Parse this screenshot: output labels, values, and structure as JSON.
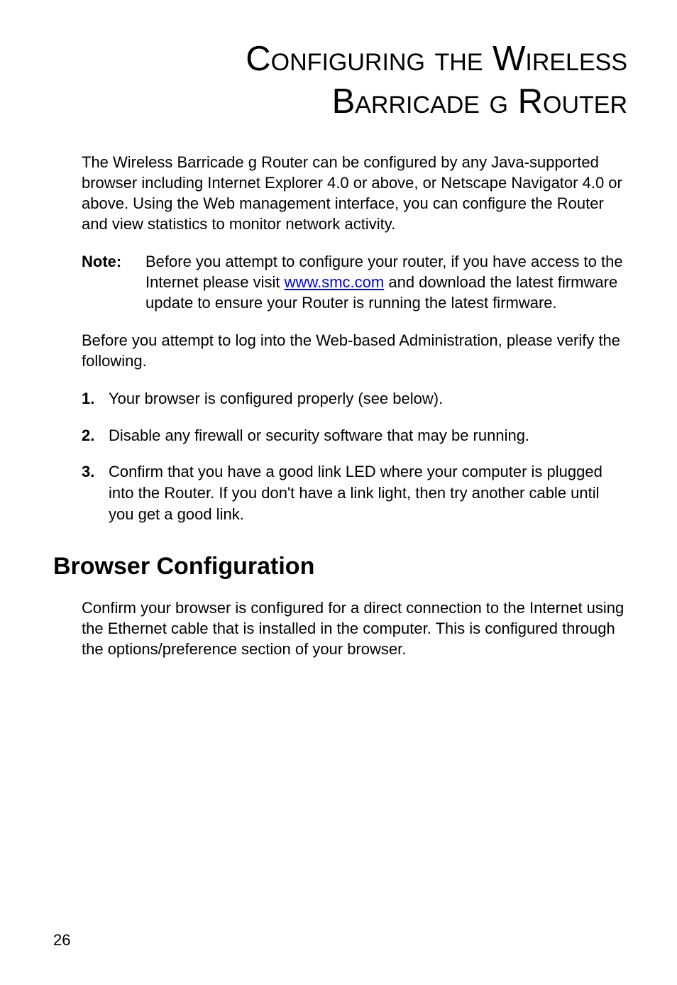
{
  "title_line1": "Configuring the Wireless",
  "title_line2": "Barricade g Router",
  "intro": "The Wireless Barricade g Router can be configured by any Java-supported browser including Internet Explorer 4.0 or above, or Netscape Navigator 4.0 or above. Using the Web management interface, you can configure the Router and view statistics to monitor network activity.",
  "note": {
    "label": "Note:",
    "before_link": "Before you attempt to configure your router, if you have access to the Internet please visit ",
    "link_text": "www.smc.com",
    "after_link": " and download the latest firmware update to ensure your Router is running the latest firmware."
  },
  "pre_list": "Before you attempt to log into the Web-based Administration, please verify the following.",
  "items": [
    {
      "num": "1.",
      "text": "Your browser is configured properly (see below)."
    },
    {
      "num": "2.",
      "text": "Disable any firewall or security software that may be running."
    },
    {
      "num": "3.",
      "text": "Confirm that you have a good link LED where your computer is plugged into the Router. If you don't have a link light, then try another cable until you get a good link."
    }
  ],
  "section_heading": "Browser Configuration",
  "section_body": "Confirm your browser is configured for a direct connection to the Internet using the Ethernet cable that is installed in the computer. This is configured through the options/preference section of your browser.",
  "page_number": "26"
}
